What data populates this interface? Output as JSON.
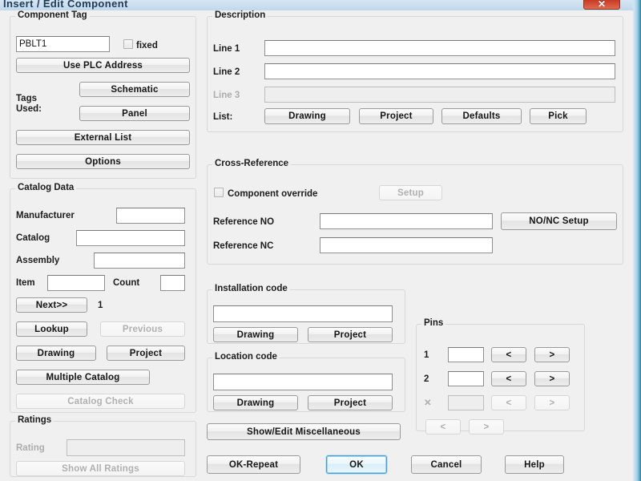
{
  "window": {
    "title": "Insert / Edit Component",
    "close_label": "✕",
    "close_icon": "close-icon"
  },
  "component_tag": {
    "caption": "Component Tag",
    "tag_value": "PBLT1",
    "fixed_label": "fixed",
    "fixed_checked": false,
    "use_plc_address": "Use PLC Address",
    "tags_used_label_line1": "Tags",
    "tags_used_label_line2": "Used:",
    "schematic": "Schematic",
    "panel": "Panel",
    "external_list": "External List",
    "options": "Options"
  },
  "catalog_data": {
    "caption": "Catalog Data",
    "manufacturer_label": "Manufacturer",
    "manufacturer_value": "",
    "catalog_label": "Catalog",
    "catalog_value": "",
    "assembly_label": "Assembly",
    "assembly_value": "",
    "item_label": "Item",
    "item_value": "",
    "count_label": "Count",
    "count_value": "",
    "next_button": "Next>>",
    "next_index": "1",
    "lookup": "Lookup",
    "previous": "Previous",
    "drawing": "Drawing",
    "project": "Project",
    "multiple_catalog": "Multiple Catalog",
    "catalog_check": "Catalog Check"
  },
  "ratings": {
    "caption": "Ratings",
    "rating_label": "Rating",
    "rating_value": "",
    "show_all_ratings": "Show All Ratings"
  },
  "description": {
    "caption": "Description",
    "line1_label": "Line 1",
    "line1_value": "",
    "line2_label": "Line 2",
    "line2_value": "",
    "line3_label": "Line 3",
    "line3_value": "",
    "list_label": "List:",
    "buttons": [
      "Drawing",
      "Project",
      "Defaults",
      "Pick"
    ]
  },
  "cross_reference": {
    "caption": "Cross-Reference",
    "component_override_label": "Component override",
    "component_override_checked": false,
    "setup": "Setup",
    "reference_no_label": "Reference NO",
    "reference_no_value": "",
    "reference_nc_label": "Reference NC",
    "reference_nc_value": "",
    "no_nc_setup": "NO/NC Setup"
  },
  "installation_code": {
    "caption": "Installation code",
    "value": "",
    "drawing": "Drawing",
    "project": "Project"
  },
  "location_code": {
    "caption": "Location code",
    "value": "",
    "drawing": "Drawing",
    "project": "Project"
  },
  "pins": {
    "caption": "Pins",
    "rows": [
      {
        "label": "1",
        "value": "",
        "prev": "<",
        "next": ">",
        "disabled": false
      },
      {
        "label": "2",
        "value": "",
        "prev": "<",
        "next": ">",
        "disabled": false
      },
      {
        "label": "✕",
        "value": "",
        "prev": "<",
        "next": ">",
        "disabled": true
      }
    ],
    "footer_prev": "<",
    "footer_next": ">"
  },
  "misc": {
    "show_edit_miscellaneous": "Show/Edit Miscellaneous"
  },
  "footer": {
    "ok_repeat": "OK-Repeat",
    "ok": "OK",
    "cancel": "Cancel",
    "help": "Help"
  },
  "colors": {
    "accent": "#4e9bc9",
    "close_red": "#d9442c",
    "dialog_bg": "#f0f0f0",
    "titlebar": "#cbdff0"
  }
}
